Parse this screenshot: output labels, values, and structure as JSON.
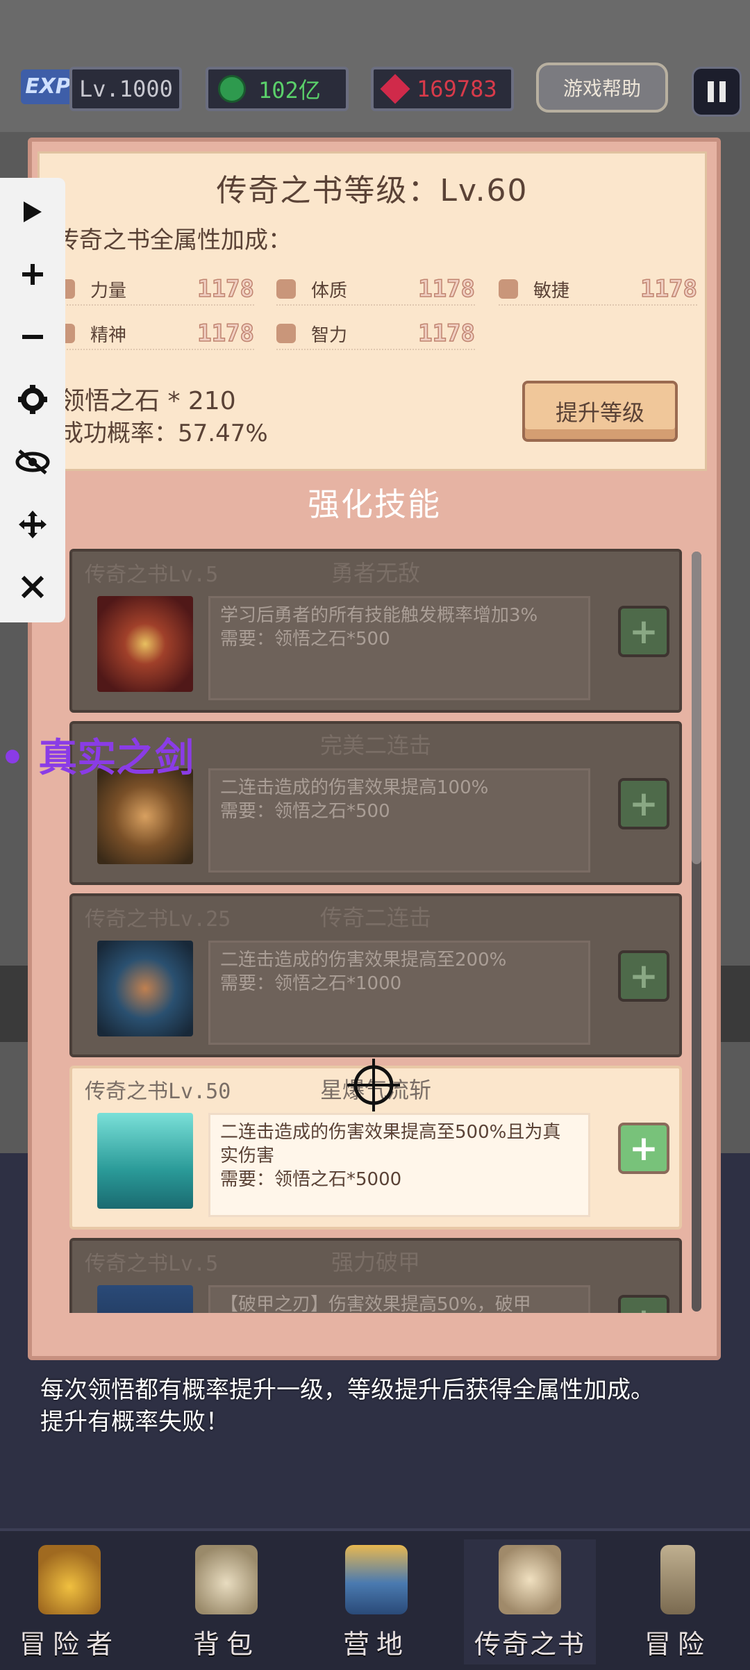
{
  "hud": {
    "exp_badge": "EXP",
    "level": "Lv.1000",
    "gold": "102亿",
    "gems": "169783",
    "help_label": "游戏帮助"
  },
  "book": {
    "title": "传奇之书等级：Lv.60",
    "bonus_title": "传奇之书全属性加成：",
    "stats": [
      {
        "name": "力量",
        "value": "1178",
        "icon": "fist-icon"
      },
      {
        "name": "体质",
        "value": "1178",
        "icon": "heart-icon"
      },
      {
        "name": "敏捷",
        "value": "1178",
        "icon": "boot-icon"
      },
      {
        "name": "精神",
        "value": "1178",
        "icon": "spirit-icon"
      },
      {
        "name": "智力",
        "value": "1178",
        "icon": "brain-icon"
      }
    ],
    "stone_line": "领悟之石 * 210",
    "rate_line": "成功概率：57.47%",
    "upgrade_label": "提升等级"
  },
  "skills_title": "强化技能",
  "skills": [
    {
      "req": "传奇之书Lv.5",
      "name": "勇者无敌",
      "desc": "学习后勇者的所有技能触发概率增加3%",
      "cost": "需要：领悟之石*500",
      "active": false
    },
    {
      "req": "",
      "name": "完美二连击",
      "desc": "二连击造成的伤害效果提高100%",
      "cost": "需要：领悟之石*500",
      "active": false
    },
    {
      "req": "传奇之书Lv.25",
      "name": "传奇二连击",
      "desc": "二连击造成的伤害效果提高至200%",
      "cost": "需要：领悟之石*1000",
      "active": false
    },
    {
      "req": "传奇之书Lv.50",
      "name": "星爆气流斩",
      "desc": "二连击造成的伤害效果提高至500%且为真实伤害",
      "cost": "需要：领悟之石*5000",
      "active": true
    },
    {
      "req": "传奇之书Lv.5",
      "name": "强力破甲",
      "desc": "【破甲之刃】伤害效果提高50%，破甲",
      "cost": "",
      "active": false
    }
  ],
  "tip": "每次领悟都有概率提升一级，等级提升后获得全属性加成。\n提升有概率失败！",
  "popup_skill": "• 真实之剑",
  "nav": [
    {
      "label": "冒险者",
      "icon": "crown-icon"
    },
    {
      "label": "背包",
      "icon": "bag-icon"
    },
    {
      "label": "营地",
      "icon": "banner-icon"
    },
    {
      "label": "传奇之书",
      "icon": "book-icon"
    },
    {
      "label": "冒险",
      "icon": "sword-icon"
    }
  ],
  "colors": {
    "panel": "#e6b3a3",
    "accent_purple": "#8a3ce6",
    "gold_text": "#5ad06a",
    "gem_text": "#d83a4a"
  }
}
